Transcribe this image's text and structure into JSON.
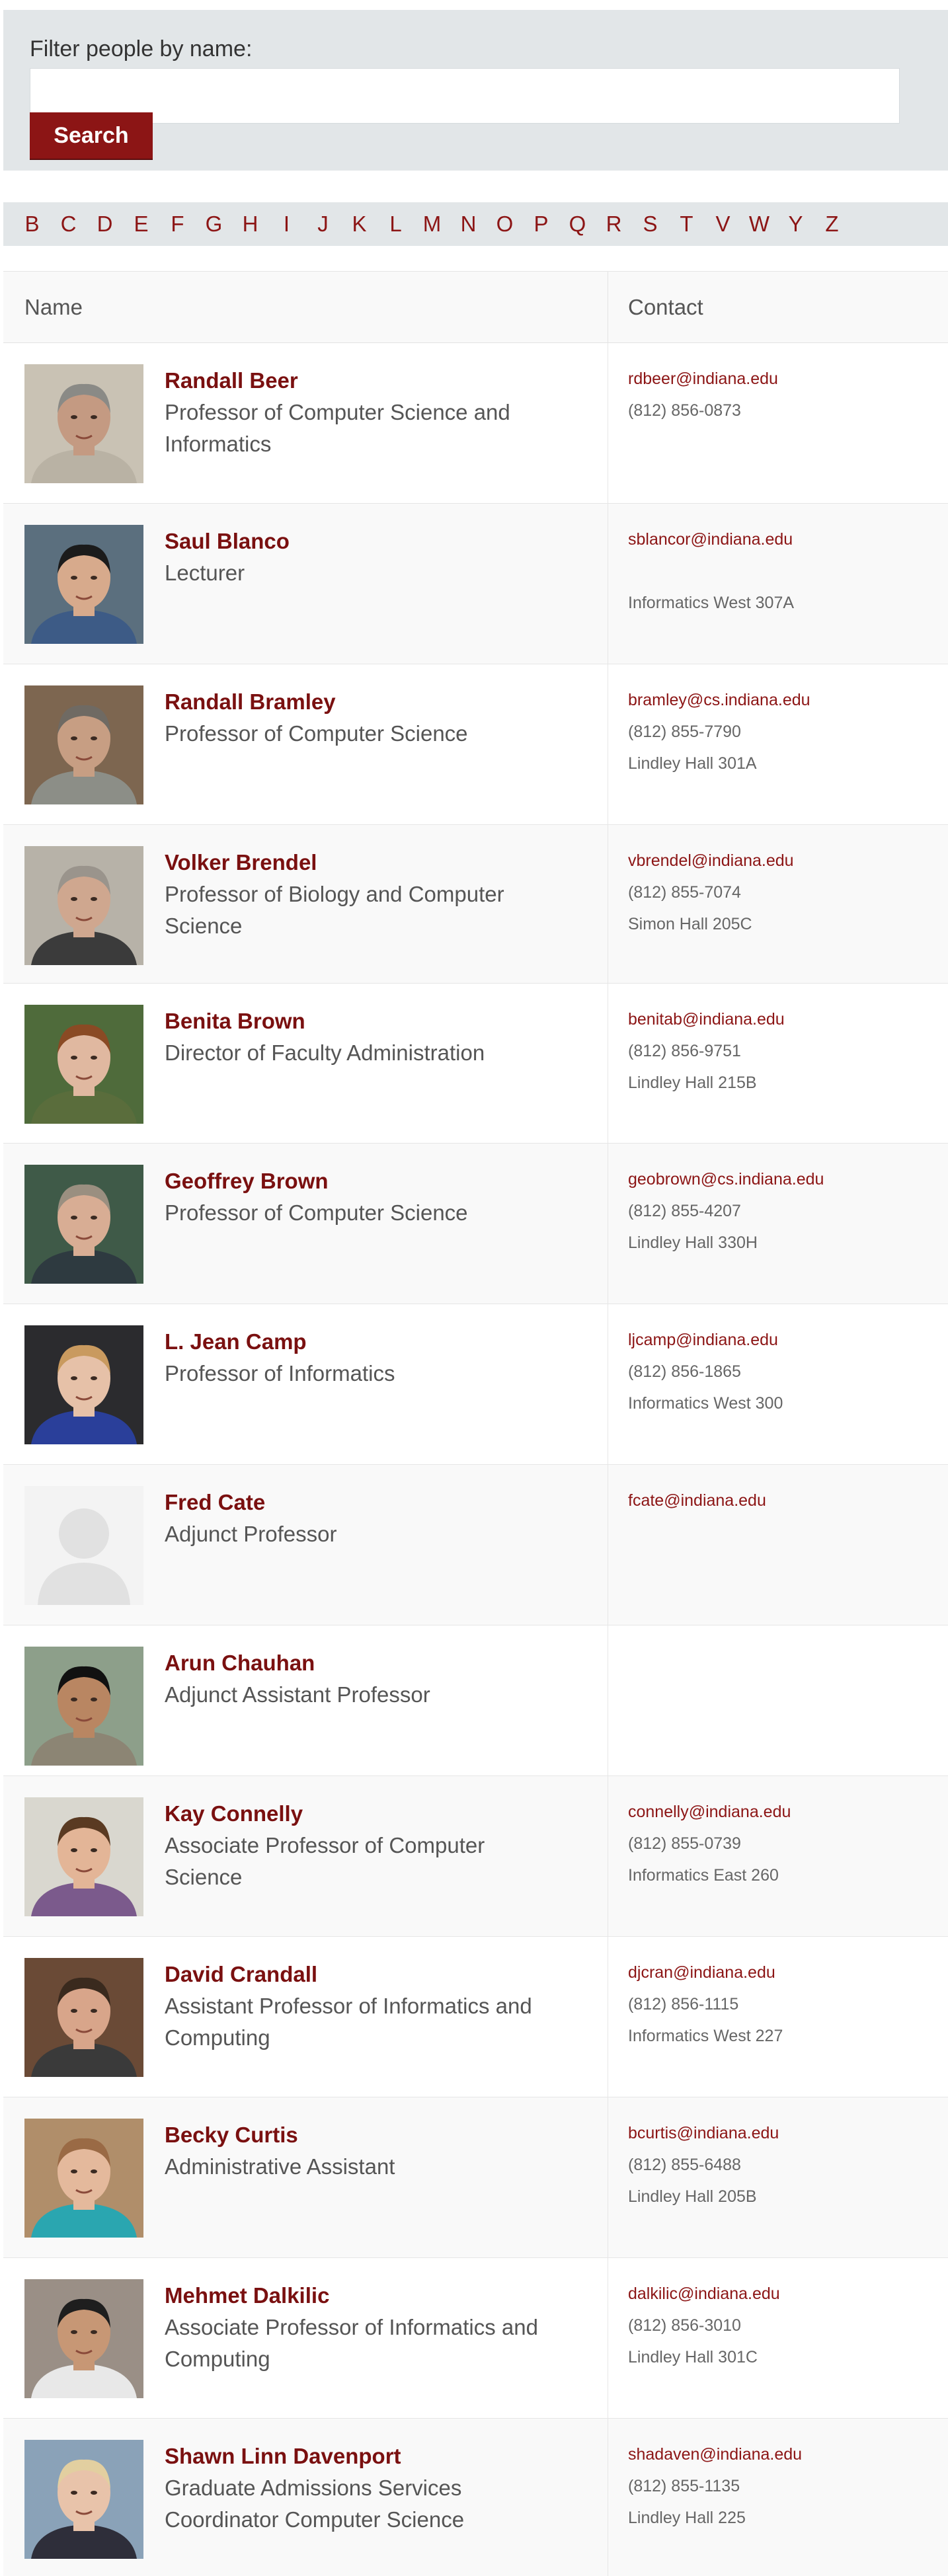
{
  "filter": {
    "label": "Filter people by name:",
    "input_value": "",
    "search_label": "Search"
  },
  "alphabet": [
    "B",
    "C",
    "D",
    "E",
    "F",
    "G",
    "H",
    "I",
    "J",
    "K",
    "L",
    "M",
    "N",
    "O",
    "P",
    "Q",
    "R",
    "S",
    "T",
    "V",
    "W",
    "Y",
    "Z"
  ],
  "table": {
    "headers": {
      "name": "Name",
      "contact": "Contact"
    },
    "people": [
      {
        "name": "Randall Beer",
        "title": "Professor of Computer Science and Informatics",
        "email": "rdbeer@indiana.edu",
        "phone": "(812) 856-0873",
        "office": "",
        "photo": "person-photo",
        "colors": {
          "bg": "#c9c2b4",
          "skin": "#c49a82",
          "hair": "#8a8a86",
          "shirt": "#b9b2a4"
        }
      },
      {
        "name": "Saul Blanco",
        "title": "Lecturer",
        "email": "sblancor@indiana.edu",
        "phone": "",
        "office": "Informatics West 307A",
        "photo": "person-photo",
        "colors": {
          "bg": "#5b6f7e",
          "skin": "#d7aa8c",
          "hair": "#1b1b1b",
          "shirt": "#3d5b86"
        }
      },
      {
        "name": "Randall Bramley",
        "title": "Professor of Computer Science",
        "email": "bramley@cs.indiana.edu",
        "phone": "(812) 855-7790",
        "office": "Lindley Hall 301A",
        "photo": "person-photo",
        "colors": {
          "bg": "#7d6650",
          "skin": "#c79e83",
          "hair": "#6f6a63",
          "shirt": "#8c8e87"
        }
      },
      {
        "name": "Volker Brendel",
        "title": "Professor of Biology and Computer Science",
        "email": "vbrendel@indiana.edu",
        "phone": "(812) 855-7074",
        "office": "Simon Hall 205C",
        "photo": "person-photo",
        "colors": {
          "bg": "#b7b2a8",
          "skin": "#cfa78f",
          "hair": "#9a948c",
          "shirt": "#3b3b3b"
        }
      },
      {
        "name": "Benita Brown",
        "title": "Director of Faculty Administration",
        "email": "benitab@indiana.edu",
        "phone": "(812) 856-9751",
        "office": "Lindley Hall 215B",
        "photo": "person-photo",
        "colors": {
          "bg": "#4f6b3b",
          "skin": "#e0b8a0",
          "hair": "#8a4a24",
          "shirt": "#5a6d3c"
        }
      },
      {
        "name": "Geoffrey Brown",
        "title": "Professor of Computer Science",
        "email": "geobrown@cs.indiana.edu",
        "phone": "(812) 855-4207",
        "office": "Lindley Hall 330H",
        "photo": "person-photo",
        "colors": {
          "bg": "#3f5a48",
          "skin": "#d8ad94",
          "hair": "#9a8f80",
          "shirt": "#2e3a40"
        }
      },
      {
        "name": "L. Jean Camp",
        "title": "Professor of Informatics",
        "email": "ljcamp@indiana.edu",
        "phone": "(812) 856-1865",
        "office": "Informatics West 300",
        "photo": "person-photo",
        "colors": {
          "bg": "#2b2b2e",
          "skin": "#e6c1a8",
          "hair": "#c99a5f",
          "shirt": "#2a3f9a"
        }
      },
      {
        "name": "Fred Cate",
        "title": "Adjunct Professor",
        "email": "fcate@indiana.edu",
        "phone": "",
        "office": "",
        "photo": "placeholder-avatar",
        "colors": {
          "bg": "#f3f3f3",
          "skin": "#e1e1e1",
          "hair": "#e1e1e1",
          "shirt": "#e1e1e1"
        }
      },
      {
        "name": "Arun Chauhan",
        "title": "Adjunct Assistant Professor",
        "email": "",
        "phone": "",
        "office": "",
        "photo": "person-photo",
        "colors": {
          "bg": "#8d9f8a",
          "skin": "#b98662",
          "hair": "#111111",
          "shirt": "#8c8574"
        }
      },
      {
        "name": "Kay Connelly",
        "title": "Associate Professor of Computer Science",
        "email": "connelly@indiana.edu",
        "phone": "(812) 855-0739",
        "office": "Informatics East 260",
        "photo": "person-photo",
        "colors": {
          "bg": "#d9d7cf",
          "skin": "#e3b597",
          "hair": "#5a3a22",
          "shirt": "#7b5a8c"
        }
      },
      {
        "name": "David Crandall",
        "title": "Assistant Professor of Informatics and Computing",
        "email": "djcran@indiana.edu",
        "phone": "(812) 856-1115",
        "office": "Informatics West 227",
        "photo": "person-photo",
        "colors": {
          "bg": "#6a4a36",
          "skin": "#d8a58a",
          "hair": "#3a2a1e",
          "shirt": "#3a3a3a"
        }
      },
      {
        "name": "Becky Curtis",
        "title": "Administrative Assistant",
        "email": "bcurtis@indiana.edu",
        "phone": "(812) 855-6488",
        "office": "Lindley Hall 205B",
        "photo": "person-photo",
        "colors": {
          "bg": "#b08e6a",
          "skin": "#e4b99c",
          "hair": "#9a6a45",
          "shirt": "#2aa6b0"
        }
      },
      {
        "name": "Mehmet Dalkilic",
        "title": "Associate Professor of Informatics and Computing",
        "email": "dalkilic@indiana.edu",
        "phone": "(812) 856-3010",
        "office": "Lindley Hall 301C",
        "photo": "person-photo",
        "colors": {
          "bg": "#9a8f86",
          "skin": "#c79775",
          "hair": "#1e1e1e",
          "shirt": "#e8e8e8"
        }
      },
      {
        "name": "Shawn Linn Davenport",
        "title": "Graduate Admissions Services Coordinator Computer Science",
        "email": "shadaven@indiana.edu",
        "phone": "(812) 855-1135",
        "office": "Lindley Hall 225",
        "photo": "person-photo",
        "colors": {
          "bg": "#8aa2b8",
          "skin": "#e8c3aa",
          "hair": "#e2cfa0",
          "shirt": "#2e2e3a"
        }
      }
    ]
  }
}
